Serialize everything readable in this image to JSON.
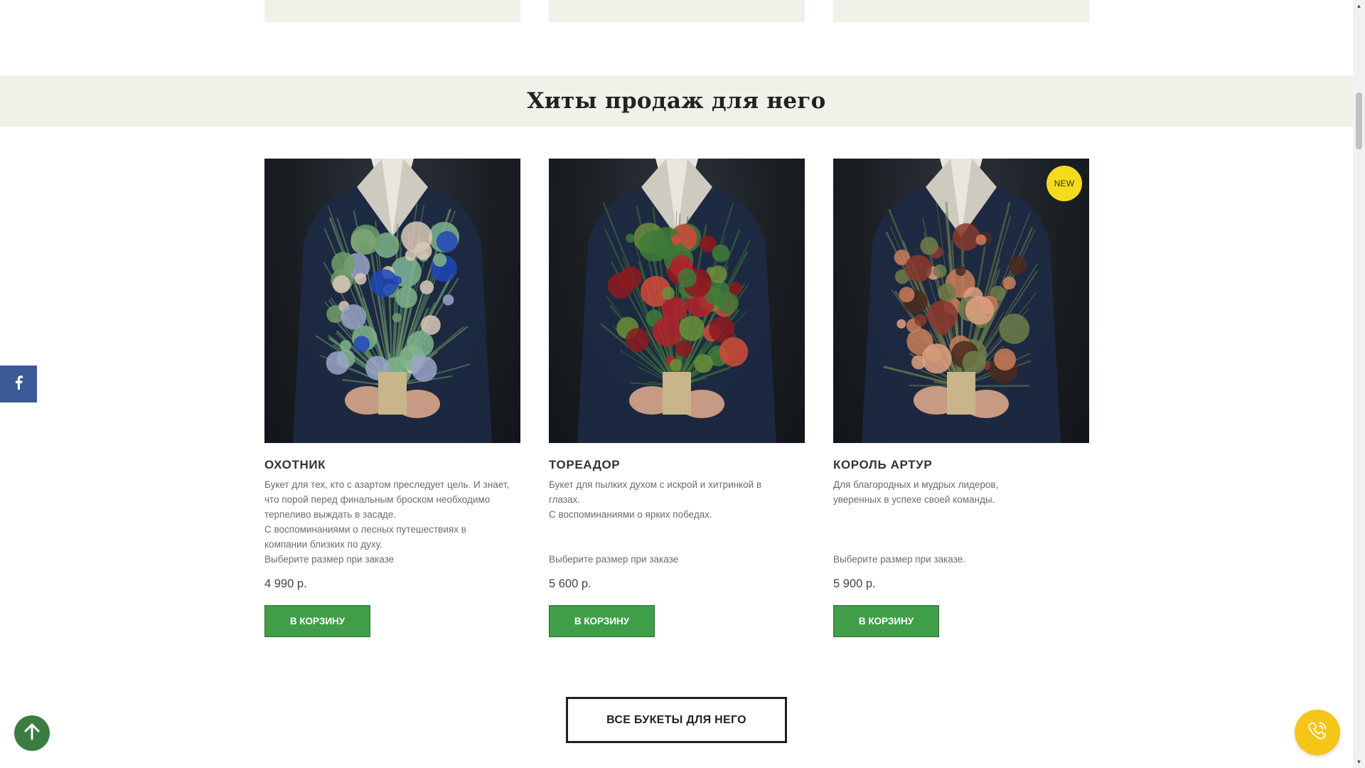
{
  "section": {
    "title": "Хиты продаж для него"
  },
  "products": [
    {
      "name": "ОХОТНИК",
      "description": "Букет для тех, кто с азартом преследует цель. И знает,\nчто порой перед финальным броском необходимо\nтерпеливо выждать в засаде.\nС воспоминаниями о лесных путешествиях в\nкомпании близких по духу.",
      "size_note": "Выберите размер при заказе",
      "price": "4 990 р.",
      "button": "В КОРЗИНУ",
      "badge": "",
      "palette": [
        "#9aa4c8",
        "#2046b8",
        "#6f9e6a",
        "#d9c9b8",
        "#7fb38c"
      ]
    },
    {
      "name": "ТОРЕАДОР",
      "description": "Букет для пылких духом с искрой и хитринкой в\nглазах.\nС воспоминаниями о ярких победах.",
      "size_note": "Выберите размер при заказе",
      "price": "5 600 р.",
      "button": "В КОРЗИНУ",
      "badge": "",
      "palette": [
        "#b3232c",
        "#8c1a20",
        "#3f7a3a",
        "#d24a3a",
        "#6a8f3b"
      ]
    },
    {
      "name": "КОРОЛЬ АРТУР",
      "description": "Для благородных и мудрых лидеров,\nуверенных в успехе своей команды.",
      "size_note": "Выберите размер при заказе.",
      "price": "5 900 р.",
      "button": "В КОРЗИНУ",
      "badge": "NEW",
      "palette": [
        "#c97e5a",
        "#8a3a2e",
        "#6f7d4a",
        "#e0a080",
        "#4a2a1e"
      ]
    }
  ],
  "all_button": "ВСЕ БУКЕТЫ ДЛЯ НЕГО",
  "icons": {
    "facebook": "facebook-icon",
    "scroll_up": "arrow-up-icon",
    "call": "phone-call-icon"
  },
  "colors": {
    "band_bg": "#eef2e8",
    "cart_button": "#3f9e47",
    "badge": "#f5da1e",
    "facebook": "#3b5a98",
    "call_button": "#f5c518",
    "scroll_up": "#3a7d43"
  }
}
